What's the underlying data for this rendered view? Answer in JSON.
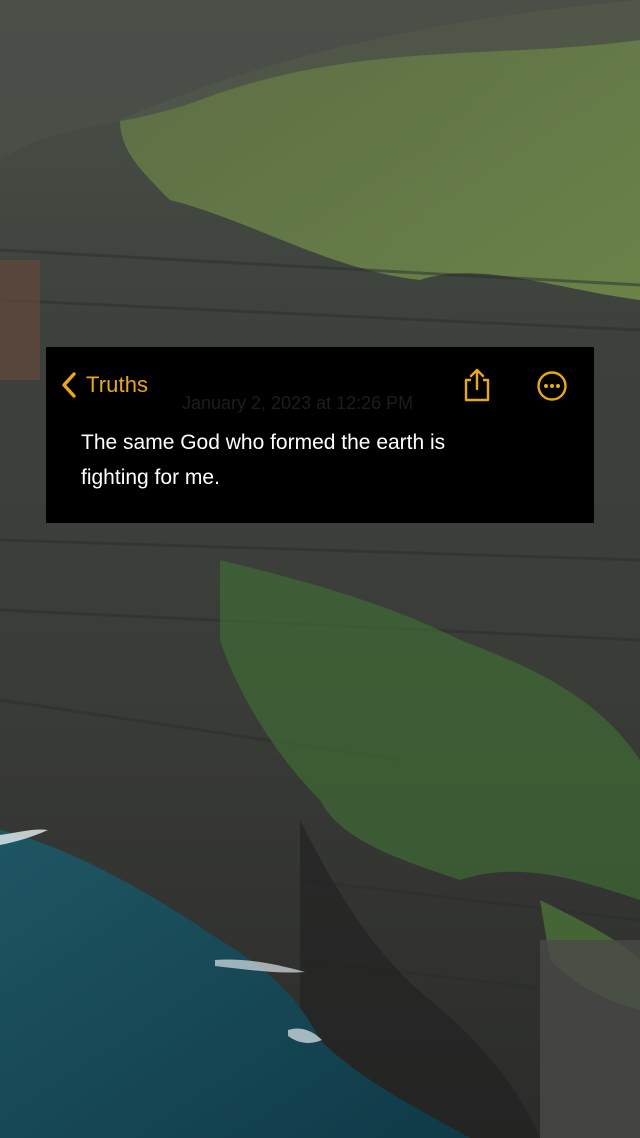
{
  "background": {
    "description_icon": "cliff-photo"
  },
  "note": {
    "back_label": "Truths",
    "date": "January 2, 2023 at 12:26 PM",
    "body_line1": "The same God who formed the earth is",
    "body_line2": "fighting for me."
  },
  "icons": {
    "back": "chevron-left-icon",
    "share": "share-icon",
    "more": "ellipsis-circle-icon"
  },
  "colors": {
    "accent": "#e8a81e",
    "card_bg": "#000000",
    "text": "#ffffff"
  }
}
